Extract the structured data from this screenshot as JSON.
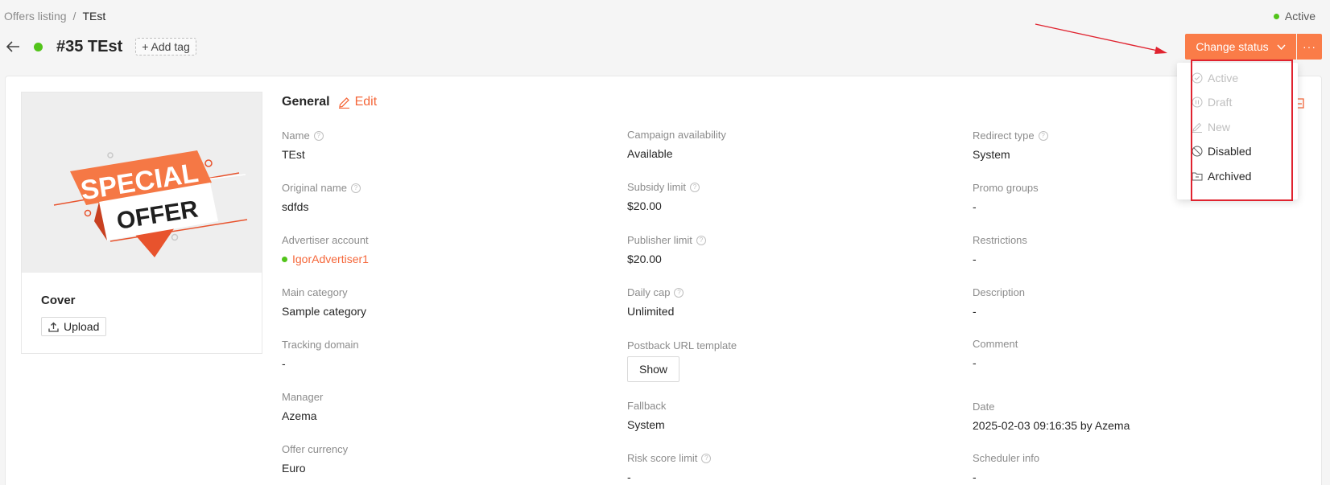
{
  "breadcrumb": {
    "parent": "Offers listing",
    "separator": "/",
    "current": "TEst"
  },
  "top_status": {
    "label": "Active",
    "color": "#52c41a"
  },
  "header": {
    "title": "#35 TEst",
    "add_tag": "+ Add tag"
  },
  "actions": {
    "change_status": "Change status",
    "more": "···"
  },
  "colors": {
    "accent": "#fa7c48",
    "link": "#f5673a",
    "active": "#52c41a"
  },
  "status_menu": [
    {
      "label": "Active",
      "icon": "check-circle-icon",
      "disabled": true
    },
    {
      "label": "Draft",
      "icon": "pause-circle-icon",
      "disabled": true
    },
    {
      "label": "New",
      "icon": "edit-icon",
      "disabled": true
    },
    {
      "label": "Disabled",
      "icon": "stop-icon",
      "disabled": false
    },
    {
      "label": "Archived",
      "icon": "folder-icon",
      "disabled": false
    }
  ],
  "cover": {
    "banner_line1": "SPECIAL",
    "banner_line2": "OFFER",
    "label": "Cover",
    "upload": "Upload"
  },
  "general": {
    "title": "General",
    "edit": "Edit"
  },
  "fields": {
    "name": {
      "label": "Name",
      "value": "TEst"
    },
    "original_name": {
      "label": "Original name",
      "value": "sdfds"
    },
    "advertiser_account": {
      "label": "Advertiser account",
      "value": "IgorAdvertiser1"
    },
    "main_category": {
      "label": "Main category",
      "value": "Sample category"
    },
    "tracking_domain": {
      "label": "Tracking domain",
      "value": "-"
    },
    "manager": {
      "label": "Manager",
      "value": "Azema"
    },
    "offer_currency": {
      "label": "Offer currency",
      "value": "Euro"
    },
    "campaign_availability": {
      "label": "Campaign availability",
      "value": "Available"
    },
    "subsidy_limit": {
      "label": "Subsidy limit",
      "value": "$20.00"
    },
    "publisher_limit": {
      "label": "Publisher limit",
      "value": "$20.00"
    },
    "daily_cap": {
      "label": "Daily cap",
      "value": "Unlimited"
    },
    "postback_url_template": {
      "label": "Postback URL template",
      "button": "Show"
    },
    "fallback": {
      "label": "Fallback",
      "value": "System"
    },
    "risk_score_limit": {
      "label": "Risk score limit",
      "value": "-"
    },
    "redirect_type": {
      "label": "Redirect type",
      "value": "System"
    },
    "promo_groups": {
      "label": "Promo groups",
      "value": "-"
    },
    "restrictions": {
      "label": "Restrictions",
      "value": "-"
    },
    "description": {
      "label": "Description",
      "value": "-"
    },
    "comment": {
      "label": "Comment",
      "value": "-"
    },
    "date": {
      "label": "Date",
      "value": "2025-02-03 09:16:35 by Azema"
    },
    "scheduler_info": {
      "label": "Scheduler info",
      "value": "-"
    }
  }
}
